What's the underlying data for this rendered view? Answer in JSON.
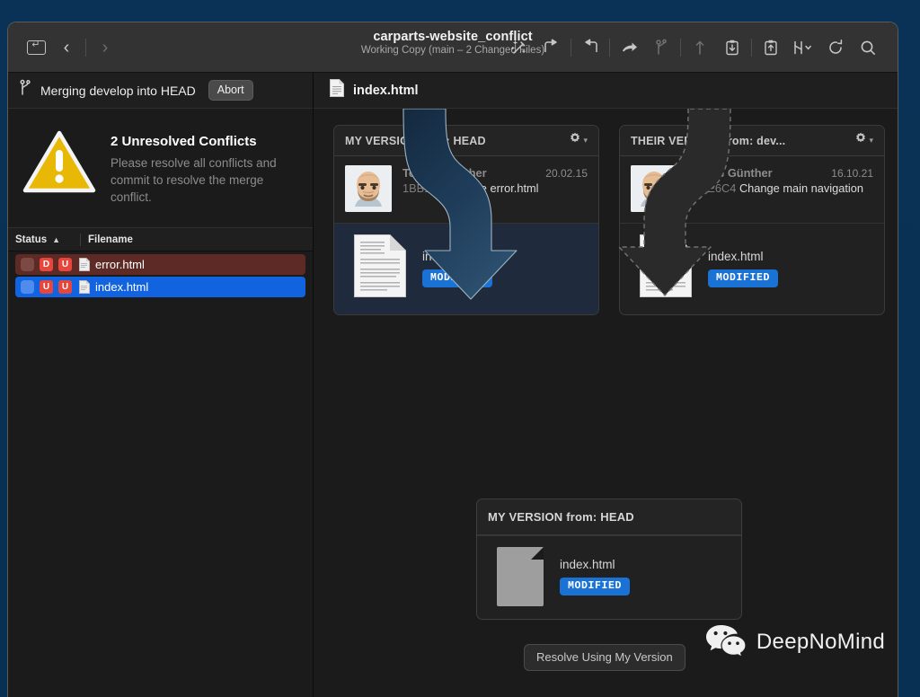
{
  "window": {
    "toolbar": {
      "repo_name": "carparts-website_conflict",
      "repo_subtitle": "Working Copy (main – 2 Changed Files)",
      "nav": {
        "sidebar_toggle": "sidebar-toggle-icon",
        "back": "chevron-left-icon",
        "forward": "chevron-right-icon"
      },
      "actions": [
        {
          "name": "magic-wand-icon",
          "enabled": true
        },
        {
          "name": "undo-arrow-icon",
          "enabled": true
        },
        {
          "name": "redo-arrow-icon",
          "enabled": true
        },
        {
          "name": "merge-arrow-icon",
          "enabled": true
        },
        {
          "name": "branch-icon",
          "enabled": false
        },
        {
          "name": "push-arrow-icon",
          "enabled": false
        },
        {
          "name": "pull-clipboard-icon",
          "enabled": true
        },
        {
          "name": "push-clipboard-icon",
          "enabled": true
        },
        {
          "name": "settings-sliders-icon",
          "enabled": true
        },
        {
          "name": "refresh-icon",
          "enabled": true
        },
        {
          "name": "search-icon",
          "enabled": true
        }
      ]
    }
  },
  "sidebar": {
    "merge_status": {
      "icon": "branch-merge-icon",
      "label": "Merging develop into HEAD",
      "abort_label": "Abort"
    },
    "conflict_banner": {
      "icon": "warning-triangle-icon",
      "title": "2 Unresolved Conflicts",
      "description": "Please resolve all conflicts and commit to resolve the merge conflict."
    },
    "list_header": {
      "status_label": "Status",
      "sort_indicator": "▲",
      "filename_label": "Filename"
    },
    "files": [
      {
        "filename": "error.html",
        "badges": [
          "D",
          "U"
        ],
        "state": "conflicted",
        "selected": false
      },
      {
        "filename": "index.html",
        "badges": [
          "U",
          "U"
        ],
        "state": "conflicted",
        "selected": true
      }
    ]
  },
  "main": {
    "header": {
      "icon": "html-file-icon",
      "title": "index.html"
    },
    "cards": [
      {
        "id": "my-version",
        "title": "MY VERSION from: HEAD",
        "gear": "gear-icon",
        "chevron": "chevron-down-icon",
        "commit": {
          "author": "Tobias Günther",
          "date": "20.02.15",
          "sha": "1BB137A",
          "subject": "Delete error.html"
        },
        "file": {
          "icon": "document-preview-icon",
          "filename": "index.html",
          "status": "MODIFIED",
          "highlighted": true
        }
      },
      {
        "id": "their-version",
        "title": "THEIR VERSION from: dev...",
        "gear": "gear-icon",
        "chevron": "chevron-down-icon",
        "commit": {
          "author": "Tobias Günther",
          "date": "16.10.21",
          "sha": "408E6C4",
          "subject": "Change main navigation"
        },
        "file": {
          "icon": "document-preview-icon",
          "filename": "index.html",
          "status": "MODIFIED",
          "highlighted": false
        }
      }
    ],
    "result": {
      "title": "MY VERSION from: HEAD",
      "file": {
        "icon": "plain-document-icon",
        "filename": "index.html",
        "status": "MODIFIED"
      }
    },
    "resolve_button": "Resolve Using My Version",
    "arrows": {
      "selected_arrow": "my-version-arrow",
      "unselected_arrow": "their-version-arrow"
    }
  },
  "watermark": {
    "icon": "wechat-icon",
    "text": "DeepNoMind"
  },
  "colors": {
    "accent_blue": "#1a72d4",
    "selection_blue": "#1263e0",
    "conflict_red": "#5e2a26",
    "badge_red": "#e8453c",
    "warning_yellow": "#e8b806",
    "desktop": "#0b3055"
  }
}
